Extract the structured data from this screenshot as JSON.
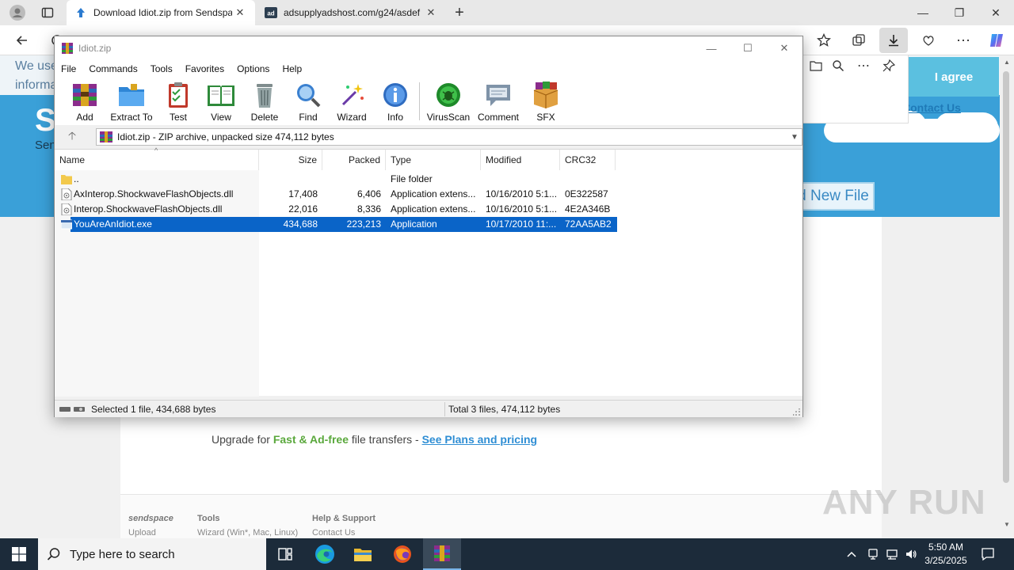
{
  "browser": {
    "tabs": [
      {
        "title": "Download Idiot.zip from Sendspace",
        "active": true
      },
      {
        "title": "adsupplyadshost.com/g24/asdef",
        "active": false
      }
    ],
    "new_tab": "+",
    "window_controls": {
      "minimize": "—",
      "restore": "❐",
      "close": "✕"
    }
  },
  "webpage": {
    "top_text_line1": "We use",
    "top_text_line2": "informa",
    "agree_button": "I agree",
    "contact_link": "Contact Us",
    "brand_letter": "S",
    "brand_sub": "Sen",
    "send_new_file": "d New File",
    "upgrade": {
      "prefix": "Upgrade for ",
      "highlight": "Fast & Ad-free",
      "middle": " file transfers - ",
      "link": "See Plans and pricing"
    },
    "footer": {
      "col1": {
        "heading": "sendspace",
        "item": "Upload"
      },
      "col2": {
        "heading": "Tools",
        "item": "Wizard (Win*, Mac, Linux)"
      },
      "col3": {
        "heading": "Help & Support",
        "item": "Contact Us"
      }
    },
    "watermark": "ANY RUN"
  },
  "winrar": {
    "title": "Idiot.zip",
    "menu": [
      "File",
      "Commands",
      "Tools",
      "Favorites",
      "Options",
      "Help"
    ],
    "toolbar": [
      {
        "label": "Add",
        "icon": "add-archive-icon"
      },
      {
        "label": "Extract To",
        "icon": "extract-folder-icon"
      },
      {
        "label": "Test",
        "icon": "test-clipboard-icon"
      },
      {
        "label": "View",
        "icon": "view-book-icon"
      },
      {
        "label": "Delete",
        "icon": "trash-icon"
      },
      {
        "label": "Find",
        "icon": "magnifier-icon"
      },
      {
        "label": "Wizard",
        "icon": "wand-icon"
      },
      {
        "label": "Info",
        "icon": "info-icon"
      },
      {
        "label": "VirusScan",
        "icon": "virus-scan-icon"
      },
      {
        "label": "Comment",
        "icon": "comment-icon"
      },
      {
        "label": "SFX",
        "icon": "sfx-box-icon"
      }
    ],
    "path": "Idiot.zip - ZIP archive, unpacked size 474,112 bytes",
    "columns": {
      "name": "Name",
      "size": "Size",
      "packed": "Packed",
      "type": "Type",
      "modified": "Modified",
      "crc": "CRC32"
    },
    "files": [
      {
        "name": "..",
        "size": "",
        "packed": "",
        "type": "File folder",
        "modified": "",
        "crc": "",
        "kind": "folder",
        "selected": false
      },
      {
        "name": "AxInterop.ShockwaveFlashObjects.dll",
        "size": "17,408",
        "packed": "6,406",
        "type": "Application extens...",
        "modified": "10/16/2010 5:1...",
        "crc": "0E322587",
        "kind": "dll",
        "selected": false
      },
      {
        "name": "Interop.ShockwaveFlashObjects.dll",
        "size": "22,016",
        "packed": "8,336",
        "type": "Application extens...",
        "modified": "10/16/2010 5:1...",
        "crc": "4E2A346B",
        "kind": "dll",
        "selected": false
      },
      {
        "name": "YouAreAnIdiot.exe",
        "size": "434,688",
        "packed": "223,213",
        "type": "Application",
        "modified": "10/17/2010 11:...",
        "crc": "72AA5AB2",
        "kind": "exe",
        "selected": true
      }
    ],
    "status_left": "Selected 1 file, 434,688 bytes",
    "status_right": "Total 3 files, 474,112 bytes"
  },
  "taskbar": {
    "search_placeholder": "Type here to search",
    "time": "5:50 AM",
    "date": "3/25/2025"
  },
  "colors": {
    "selection": "#0a64c8",
    "taskbar": "#1c2b3a",
    "page_blue": "#3aa0d8"
  }
}
